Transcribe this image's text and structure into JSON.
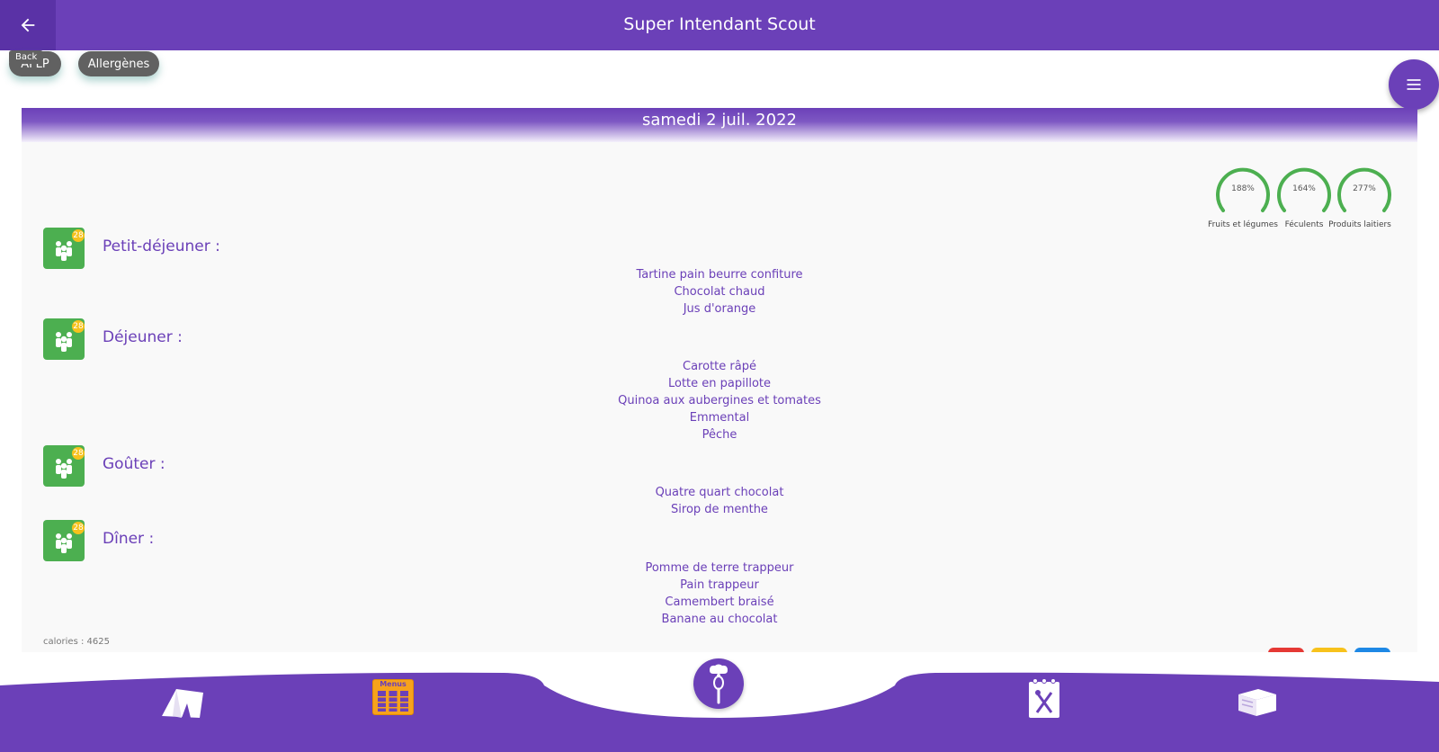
{
  "appbar": {
    "title": "Super Intendant Scout",
    "back_tooltip": "Back"
  },
  "chips": {
    "first": "AFLP",
    "allergens": "Allergènes"
  },
  "day": {
    "date": "samedi 2 juil. 2022",
    "gauges": [
      {
        "label": "Fruits et légumes",
        "value": "188%"
      },
      {
        "label": "Féculents",
        "value": "164%"
      },
      {
        "label": "Produits laitiers",
        "value": "277%"
      }
    ],
    "meals": [
      {
        "title": "Petit-déjeuner :",
        "count": "28",
        "items": [
          "Tartine pain beurre confiture",
          "Chocolat chaud",
          "Jus d'orange"
        ]
      },
      {
        "title": "Déjeuner :",
        "count": "28",
        "items": [
          "Carotte râpé",
          "Lotte en papillote",
          "Quinoa aux aubergines et tomates",
          "Emmental",
          "Pêche"
        ]
      },
      {
        "title": "Goûter :",
        "count": "28",
        "items": [
          "Quatre quart chocolat",
          "Sirop de menthe"
        ]
      },
      {
        "title": "Dîner :",
        "count": "28",
        "items": [
          "Pomme de terre trappeur",
          "Pain trappeur",
          "Camembert braisé",
          "Banane au chocolat"
        ]
      }
    ],
    "calories": "calories : 4625"
  },
  "bottom_nav": {
    "menus_label": "Menus"
  },
  "colors": {
    "primary": "#6b40b8",
    "meal_icon": "#4caf50",
    "badge": "#f7c21c",
    "gauge": "#4caf50"
  },
  "icons": [
    "back-arrow-icon",
    "menu-icon",
    "group-icon",
    "tent-icon",
    "menus-icon",
    "chef-whisk-icon",
    "recipe-notepad-icon",
    "storage-box-icon"
  ]
}
